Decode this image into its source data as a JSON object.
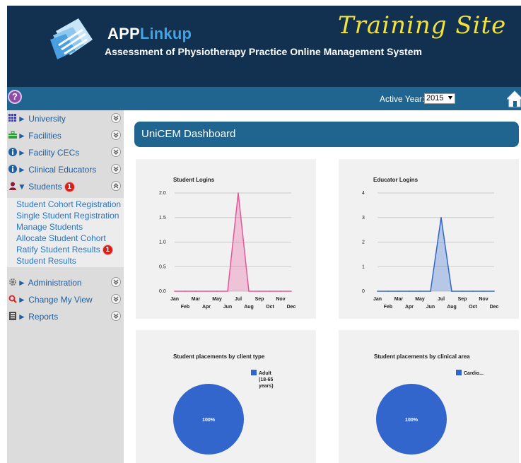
{
  "header": {
    "brand_prefix": "APP",
    "brand_suffix": "Linkup",
    "tagline": "Assessment of Physiotherapy Practice Online Management System",
    "site_label": "Training Site"
  },
  "toolbar": {
    "help_glyph": "?",
    "active_year_label": "Active Year:",
    "active_year_value": "2015"
  },
  "sidebar": {
    "items": [
      {
        "label": "University",
        "arrow": "►",
        "icon": "grid-icon"
      },
      {
        "label": "Facilities",
        "arrow": "►",
        "icon": "briefcase-icon"
      },
      {
        "label": "Facility CECs",
        "arrow": "►",
        "icon": "info-icon"
      },
      {
        "label": "Clinical Educators",
        "arrow": "►",
        "icon": "info-icon"
      },
      {
        "label": "Students",
        "arrow": "▼",
        "icon": "user-icon",
        "badge": "1"
      },
      {
        "label": "Administration",
        "arrow": "►",
        "icon": "gear-icon"
      },
      {
        "label": "Change My View",
        "arrow": "►",
        "icon": "magnifier-icon"
      },
      {
        "label": "Reports",
        "arrow": "►",
        "icon": "report-icon"
      }
    ],
    "students_sub": [
      {
        "label": "Student Cohort Registration"
      },
      {
        "label": "Single Student Registration"
      },
      {
        "label": "Manage Students"
      },
      {
        "label": "Allocate Student Cohort"
      },
      {
        "label": "Ratify Student Results",
        "badge": "1"
      },
      {
        "label": "Student Results"
      }
    ]
  },
  "main": {
    "title": "UniCEM Dashboard"
  },
  "colors": {
    "header_bg": "#12304f",
    "bar_bg": "#1f6590",
    "training_site": "#f2e23a",
    "link": "#2a76c6",
    "pink_series": "#e8559b",
    "blue_series": "#3366cc"
  },
  "chart_data": [
    {
      "type": "area",
      "title": "Student Logins",
      "categories": [
        "Jan",
        "Feb",
        "Mar",
        "Apr",
        "May",
        "Jun",
        "Jul",
        "Aug",
        "Sep",
        "Oct",
        "Nov",
        "Dec"
      ],
      "values": [
        0,
        0,
        0,
        0,
        0,
        0,
        2,
        0,
        0,
        0,
        0,
        0
      ],
      "ylim": [
        0,
        2
      ],
      "yticks": [
        "0.0",
        "0.5",
        "1.0",
        "1.5",
        "2.0"
      ],
      "grid": true,
      "color": "#e8559b"
    },
    {
      "type": "area",
      "title": "Educator Logins",
      "categories": [
        "Jan",
        "Feb",
        "Mar",
        "Apr",
        "May",
        "Jun",
        "Jul",
        "Aug",
        "Sep",
        "Oct",
        "Nov",
        "Dec"
      ],
      "values": [
        0,
        0,
        0,
        0,
        0,
        0,
        3,
        0,
        0,
        0,
        0,
        0
      ],
      "ylim": [
        0,
        4
      ],
      "yticks": [
        "0",
        "1",
        "2",
        "3",
        "4"
      ],
      "grid": true,
      "color": "#3366cc"
    },
    {
      "type": "pie",
      "title": "Student placements by client type",
      "slices": [
        {
          "label": "Adult (18-65 years)",
          "legend_lines": [
            "Adult",
            "(18-65",
            "years)"
          ],
          "value": 100,
          "display": "100%"
        }
      ],
      "legend": "right",
      "color": "#3366cc"
    },
    {
      "type": "pie",
      "title": "Student placements by clinical area",
      "slices": [
        {
          "label": "Cardio...",
          "legend_lines": [
            "Cardio..."
          ],
          "value": 100,
          "display": "100%"
        }
      ],
      "legend": "top-right",
      "color": "#3366cc"
    }
  ]
}
